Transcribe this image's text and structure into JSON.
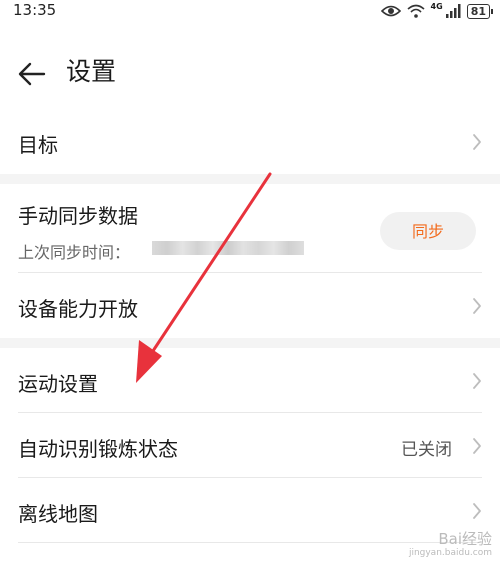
{
  "status_bar": {
    "time": "13:35",
    "network": "4G",
    "battery": "81"
  },
  "header": {
    "title": "设置"
  },
  "rows": {
    "goal": {
      "label": "目标"
    },
    "manual_sync": {
      "label": "手动同步数据",
      "last_sync_label": "上次同步时间：",
      "sync_button_label": "同步"
    },
    "device_capability": {
      "label": "设备能力开放"
    },
    "exercise_settings": {
      "label": "运动设置"
    },
    "auto_recognize": {
      "label": "自动识别锻炼状态",
      "value": "已关闭"
    },
    "offline_map": {
      "label": "离线地图"
    }
  },
  "watermark": {
    "brand": "Bai经验",
    "url": "jingyan.baidu.com"
  },
  "colors": {
    "accent": "#f26b1d",
    "annotation_arrow": "#e8323c",
    "section_gap": "#f4f4f4"
  }
}
